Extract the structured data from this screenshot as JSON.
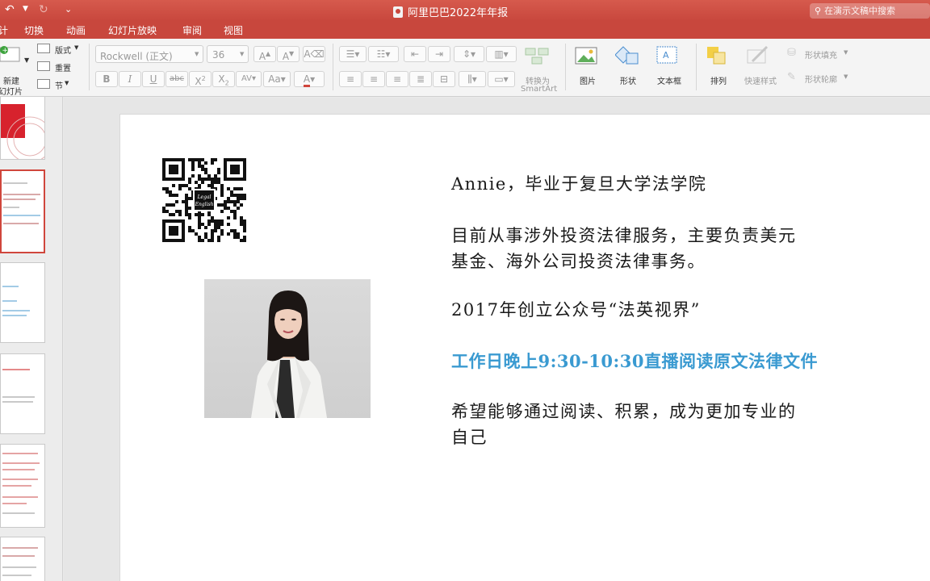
{
  "window": {
    "title": "阿里巴巴2022年年报",
    "search_placeholder": "在演示文稿中搜索"
  },
  "menu_tabs": [
    "切换",
    "动画",
    "幻灯片放映",
    "审阅",
    "视图"
  ],
  "ribbon": {
    "new_slide_line1": "新建",
    "new_slide_line2": "幻灯片",
    "layout": "版式",
    "reset": "重置",
    "section": "节",
    "font_name": "Rockwell (正文)",
    "font_size": "36",
    "convert_line1": "转换为",
    "convert_line2": "SmartArt",
    "picture": "图片",
    "shape": "形状",
    "textbox": "文本框",
    "arrange": "排列",
    "quick_styles": "快速样式",
    "shape_fill": "形状填充",
    "shape_outline": "形状轮廓"
  },
  "slide": {
    "line1": "Annie，毕业于复旦大学法学院",
    "line2a": "目前从事涉外投资法律服务，主要负责美元",
    "line2b": "基金、海外公司投资法律事务。",
    "line3": "2017年创立公众号“法英视界”",
    "line4": "工作日晚上9:30-10:30直播阅读原文法律文件",
    "line5a": "希望能够通过阅读、积累，成为更加专业的",
    "line5b": "自己",
    "qr_center_line1": "Legal",
    "qr_center_line2": "English"
  },
  "colors": {
    "brand": "#c8473d",
    "highlight_text": "#3a9ad1"
  }
}
